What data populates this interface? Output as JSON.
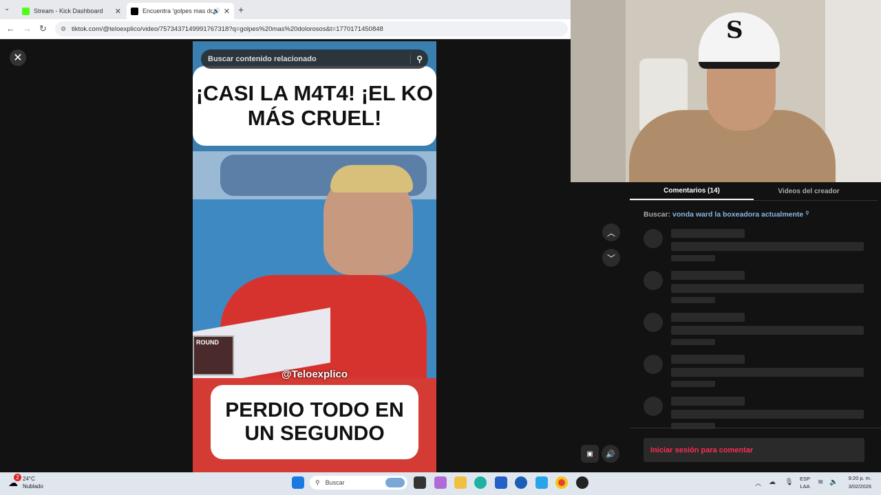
{
  "browser": {
    "tabs": [
      {
        "label": "Stream - Kick Dashboard",
        "favicon_color": "#53fc18"
      },
      {
        "label": "Encuentra 'golpes mas dol...",
        "favicon_color": "#000000"
      }
    ],
    "url": "tiktok.com/@teloexplico/video/7573437149991767318?q=golpes%20mas%20dolorosos&t=1770171450848"
  },
  "tiktok": {
    "search_placeholder": "Buscar contenido relacionado",
    "caption_top": "¡CASI LA M4T4! ¡EL KO MÁS CRUEL!",
    "caption_bottom": "PERDIO TODO EN UN SEGUNDO",
    "watermark": "@Teloexplico",
    "tabs": [
      {
        "label": "Comentarios (14)",
        "active": true
      },
      {
        "label": "Videos del creador",
        "active": false
      }
    ],
    "search_prefix": "Buscar:",
    "search_query": "vonda ward la boxeadora actualmente",
    "comment_prompt": "Iniciar sesión para comentar"
  },
  "taskbar": {
    "weather_temp": "24°C",
    "weather_desc": "Nublado",
    "weather_badge": "2",
    "search_label": "Buscar",
    "lang_top": "ESP",
    "lang_bottom": "LAA",
    "time": "9:20 p. m.",
    "date": "3/02/2026"
  }
}
